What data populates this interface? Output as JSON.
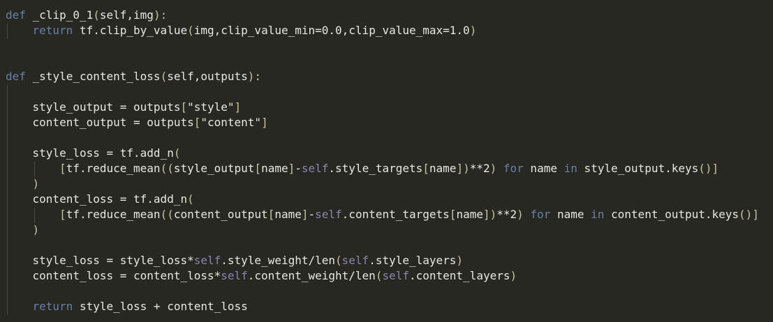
{
  "colors": {
    "background": "#272822",
    "keyword": "#6a7fa8",
    "self": "#8a86b0",
    "text": "#e8e8e0",
    "paren": "#c9c3a2",
    "indent_guide": "#4a4a45"
  },
  "code": {
    "l1": [
      {
        "t": "def",
        "c": "kw"
      },
      {
        "t": " _clip_0_1",
        "c": "plain"
      },
      {
        "t": "(",
        "c": "paren"
      },
      {
        "t": "self,img",
        "c": "plain"
      },
      {
        "t": "):",
        "c": "paren"
      }
    ],
    "l2": [
      {
        "t": "    ",
        "c": "plain"
      },
      {
        "t": "return",
        "c": "kw"
      },
      {
        "t": " tf.clip_by_value",
        "c": "plain"
      },
      {
        "t": "(",
        "c": "paren"
      },
      {
        "t": "img,clip_value_min=0.0,clip_value_max=1.0",
        "c": "plain"
      },
      {
        "t": ")",
        "c": "paren"
      }
    ],
    "l3": [
      {
        "t": "def",
        "c": "kw"
      },
      {
        "t": " _style_content_loss",
        "c": "plain"
      },
      {
        "t": "(",
        "c": "paren"
      },
      {
        "t": "self,outputs",
        "c": "plain"
      },
      {
        "t": "):",
        "c": "paren"
      }
    ],
    "l4": [
      {
        "t": "    style_output = outputs",
        "c": "plain"
      },
      {
        "t": "[",
        "c": "paren"
      },
      {
        "t": "\"style\"",
        "c": "plain"
      },
      {
        "t": "]",
        "c": "paren"
      }
    ],
    "l5": [
      {
        "t": "    content_output = outputs",
        "c": "plain"
      },
      {
        "t": "[",
        "c": "paren"
      },
      {
        "t": "\"content\"",
        "c": "plain"
      },
      {
        "t": "]",
        "c": "paren"
      }
    ],
    "l6": [
      {
        "t": "    style_loss = tf.add_n",
        "c": "plain"
      },
      {
        "t": "(",
        "c": "paren"
      }
    ],
    "l7": [
      {
        "t": "        ",
        "c": "plain"
      },
      {
        "t": "[",
        "c": "paren"
      },
      {
        "t": "tf.reduce_mean",
        "c": "plain"
      },
      {
        "t": "((",
        "c": "paren"
      },
      {
        "t": "style_output",
        "c": "plain"
      },
      {
        "t": "[",
        "c": "paren"
      },
      {
        "t": "name",
        "c": "plain"
      },
      {
        "t": "]",
        "c": "paren"
      },
      {
        "t": "-",
        "c": "plain"
      },
      {
        "t": "self",
        "c": "self"
      },
      {
        "t": ".style_targets",
        "c": "plain"
      },
      {
        "t": "[",
        "c": "paren"
      },
      {
        "t": "name",
        "c": "plain"
      },
      {
        "t": "])",
        "c": "paren"
      },
      {
        "t": "**2",
        "c": "plain"
      },
      {
        "t": ")",
        "c": "paren"
      },
      {
        "t": " ",
        "c": "plain"
      },
      {
        "t": "for",
        "c": "kw"
      },
      {
        "t": " name ",
        "c": "plain"
      },
      {
        "t": "in",
        "c": "kw"
      },
      {
        "t": " style_output.keys",
        "c": "plain"
      },
      {
        "t": "()]",
        "c": "paren"
      }
    ],
    "l8": [
      {
        "t": "    ",
        "c": "plain"
      },
      {
        "t": ")",
        "c": "paren"
      }
    ],
    "l9": [
      {
        "t": "    content_loss = tf.add_n",
        "c": "plain"
      },
      {
        "t": "(",
        "c": "paren"
      }
    ],
    "l10": [
      {
        "t": "        ",
        "c": "plain"
      },
      {
        "t": "[",
        "c": "paren"
      },
      {
        "t": "tf.reduce_mean",
        "c": "plain"
      },
      {
        "t": "((",
        "c": "paren"
      },
      {
        "t": "content_output",
        "c": "plain"
      },
      {
        "t": "[",
        "c": "paren"
      },
      {
        "t": "name",
        "c": "plain"
      },
      {
        "t": "]",
        "c": "paren"
      },
      {
        "t": "-",
        "c": "plain"
      },
      {
        "t": "self",
        "c": "self"
      },
      {
        "t": ".content_targets",
        "c": "plain"
      },
      {
        "t": "[",
        "c": "paren"
      },
      {
        "t": "name",
        "c": "plain"
      },
      {
        "t": "])",
        "c": "paren"
      },
      {
        "t": "**2",
        "c": "plain"
      },
      {
        "t": ")",
        "c": "paren"
      },
      {
        "t": " ",
        "c": "plain"
      },
      {
        "t": "for",
        "c": "kw"
      },
      {
        "t": " name ",
        "c": "plain"
      },
      {
        "t": "in",
        "c": "kw"
      },
      {
        "t": " content_output.keys",
        "c": "plain"
      },
      {
        "t": "()]",
        "c": "paren"
      }
    ],
    "l11": [
      {
        "t": "    ",
        "c": "plain"
      },
      {
        "t": ")",
        "c": "paren"
      }
    ],
    "l12": [
      {
        "t": "    style_loss = style_loss*",
        "c": "plain"
      },
      {
        "t": "self",
        "c": "self"
      },
      {
        "t": ".style_weight/len",
        "c": "plain"
      },
      {
        "t": "(",
        "c": "paren"
      },
      {
        "t": "self",
        "c": "self"
      },
      {
        "t": ".style_layers",
        "c": "plain"
      },
      {
        "t": ")",
        "c": "paren"
      }
    ],
    "l13": [
      {
        "t": "    content_loss = content_loss*",
        "c": "plain"
      },
      {
        "t": "self",
        "c": "self"
      },
      {
        "t": ".content_weight/len",
        "c": "plain"
      },
      {
        "t": "(",
        "c": "paren"
      },
      {
        "t": "self",
        "c": "self"
      },
      {
        "t": ".content_layers",
        "c": "plain"
      },
      {
        "t": ")",
        "c": "paren"
      }
    ],
    "l14": [
      {
        "t": "    ",
        "c": "plain"
      },
      {
        "t": "return",
        "c": "kw"
      },
      {
        "t": " style_loss + content_loss",
        "c": "plain"
      }
    ]
  }
}
